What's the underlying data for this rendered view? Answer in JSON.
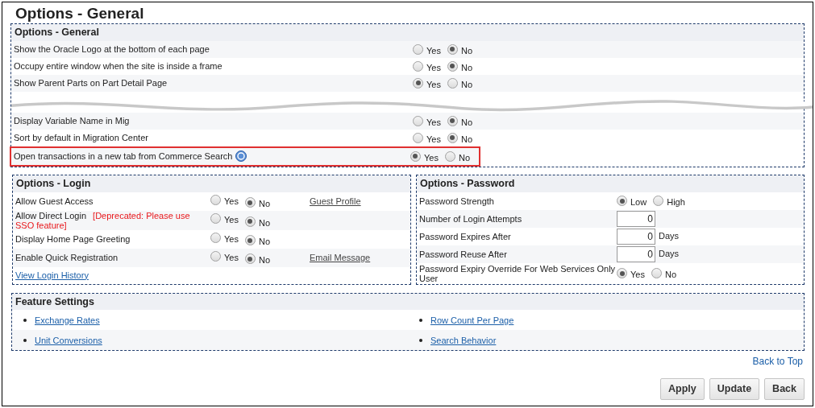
{
  "page_title": "Options - General",
  "general": {
    "title": "Options - General",
    "rows_before_tear": [
      {
        "label": "Show the Oracle Logo at the bottom of each page",
        "highlighted": false,
        "help": false,
        "options": [
          {
            "label": "Yes",
            "selected": false
          },
          {
            "label": "No",
            "selected": true
          }
        ]
      },
      {
        "label": "Occupy entire window when the site is inside a frame",
        "highlighted": false,
        "help": false,
        "options": [
          {
            "label": "Yes",
            "selected": false
          },
          {
            "label": "No",
            "selected": true
          }
        ]
      },
      {
        "label": "Show Parent Parts on Part Detail Page",
        "highlighted": false,
        "help": false,
        "options": [
          {
            "label": "Yes",
            "selected": true
          },
          {
            "label": "No",
            "selected": false
          }
        ]
      }
    ],
    "rows_after_tear": [
      {
        "label": "Display Variable Name in Mig",
        "highlighted": false,
        "help": false,
        "options": [
          {
            "label": "Yes",
            "selected": false
          },
          {
            "label": "No",
            "selected": true
          }
        ]
      },
      {
        "label": "Sort by default in Migration Center",
        "highlighted": false,
        "help": false,
        "options": [
          {
            "label": "Yes",
            "selected": false
          },
          {
            "label": "No",
            "selected": true
          }
        ]
      },
      {
        "label": "Open transactions in a new tab from Commerce Search",
        "highlighted": true,
        "help": true,
        "options": [
          {
            "label": "Yes",
            "selected": true
          },
          {
            "label": "No",
            "selected": false
          }
        ]
      }
    ]
  },
  "login": {
    "title": "Options - Login",
    "rows": [
      {
        "label": "Allow Guest Access",
        "options": [
          {
            "label": "Yes",
            "selected": false
          },
          {
            "label": "No",
            "selected": true
          }
        ],
        "link": "Guest Profile"
      },
      {
        "label": "Allow Direct Login",
        "note": "[Deprecated: Please use SSO feature]",
        "options": [
          {
            "label": "Yes",
            "selected": false
          },
          {
            "label": "No",
            "selected": true
          }
        ]
      },
      {
        "label": "Display Home Page Greeting",
        "options": [
          {
            "label": "Yes",
            "selected": false
          },
          {
            "label": "No",
            "selected": true
          }
        ]
      },
      {
        "label": "Enable Quick Registration",
        "options": [
          {
            "label": "Yes",
            "selected": false
          },
          {
            "label": "No",
            "selected": true
          }
        ],
        "link": "Email Message"
      }
    ],
    "footer_link": "View Login History"
  },
  "password": {
    "title": "Options - Password",
    "rows": [
      {
        "kind": "radio",
        "label": "Password Strength",
        "options": [
          {
            "label": "Low",
            "selected": true
          },
          {
            "label": "High",
            "selected": false
          }
        ]
      },
      {
        "kind": "input",
        "label": "Number of Login Attempts",
        "value": "0"
      },
      {
        "kind": "input",
        "label": "Password Expires After",
        "value": "0",
        "unit": "Days"
      },
      {
        "kind": "input",
        "label": "Password Reuse After",
        "value": "0",
        "unit": "Days"
      },
      {
        "kind": "radio",
        "label": "Password Expiry Override For Web Services Only User",
        "options": [
          {
            "label": "Yes",
            "selected": true
          },
          {
            "label": "No",
            "selected": false
          }
        ]
      }
    ]
  },
  "features": {
    "title": "Feature Settings",
    "rows": [
      [
        "Exchange Rates",
        "Row Count Per Page"
      ],
      [
        "Unit Conversions",
        "Search Behavior"
      ]
    ]
  },
  "back_to_top": "Back to Top",
  "buttons": [
    "Apply",
    "Update",
    "Back"
  ]
}
